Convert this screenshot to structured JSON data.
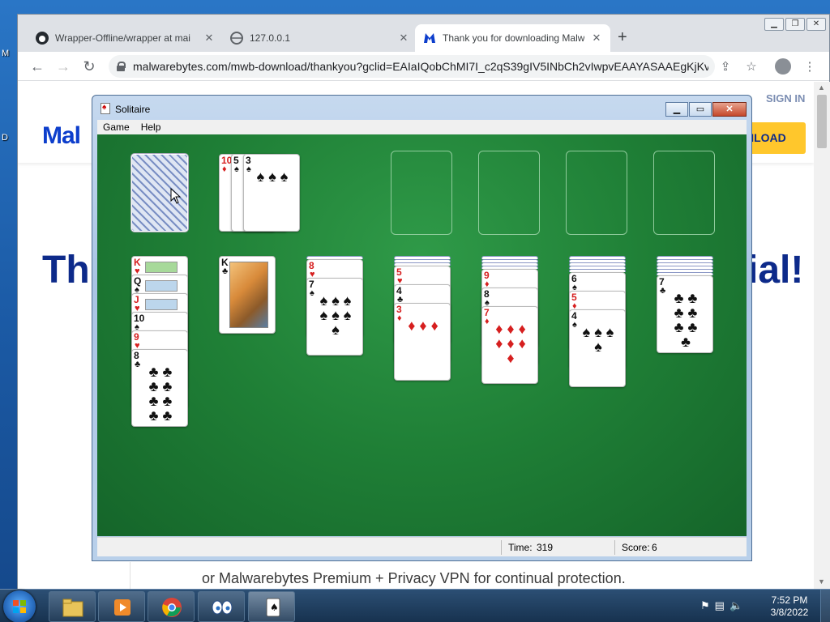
{
  "desktop": {
    "side_labels": [
      "M",
      "D"
    ]
  },
  "browser": {
    "tabs": [
      {
        "title": "Wrapper-Offline/wrapper at mai",
        "icon": "github-icon",
        "active": false
      },
      {
        "title": "127.0.0.1",
        "icon": "globe-icon",
        "active": false
      },
      {
        "title": "Thank you for downloading Malw",
        "icon": "malwarebytes-icon",
        "active": true
      }
    ],
    "new_tab": "+",
    "url": "malwarebytes.com/mwb-download/thankyou?gclid=EAIaIQobChMI7I_c2qS39gIV5INbCh2vIwpvEAAYASAAEgKjKv...",
    "page": {
      "sign_in": "SIGN IN",
      "logo_text": "Mal",
      "download_btn": "NLOAD",
      "hero_left": "Th",
      "hero_right": "ial!",
      "footer": "or Malwarebytes Premium + Privacy VPN for continual protection."
    }
  },
  "solitaire": {
    "title": "Solitaire",
    "menu": [
      "Game",
      "Help"
    ],
    "status": {
      "time_label": "Time:",
      "time_value": "319",
      "score_label": "Score:",
      "score_value": "6"
    },
    "waste": [
      {
        "rank": "10",
        "suit": "♦",
        "color": "red"
      },
      {
        "rank": "5",
        "suit": "♠",
        "color": "black"
      },
      {
        "rank": "3",
        "suit": "♠",
        "color": "black"
      }
    ],
    "tableau": [
      {
        "hidden": 0,
        "cards": [
          {
            "rank": "K",
            "suit": "♥",
            "color": "red"
          },
          {
            "rank": "Q",
            "suit": "♠",
            "color": "black"
          },
          {
            "rank": "J",
            "suit": "♥",
            "color": "red"
          },
          {
            "rank": "10",
            "suit": "♠",
            "color": "black"
          },
          {
            "rank": "9",
            "suit": "♥",
            "color": "red"
          },
          {
            "rank": "8",
            "suit": "♣",
            "color": "black"
          }
        ]
      },
      {
        "hidden": 0,
        "cards": [
          {
            "rank": "K",
            "suit": "♣",
            "color": "black"
          }
        ]
      },
      {
        "hidden": 1,
        "cards": [
          {
            "rank": "8",
            "suit": "♥",
            "color": "red"
          },
          {
            "rank": "7",
            "suit": "♠",
            "color": "black"
          }
        ]
      },
      {
        "hidden": 3,
        "cards": [
          {
            "rank": "5",
            "suit": "♥",
            "color": "red"
          },
          {
            "rank": "4",
            "suit": "♣",
            "color": "black"
          },
          {
            "rank": "3",
            "suit": "♦",
            "color": "red"
          }
        ]
      },
      {
        "hidden": 4,
        "cards": [
          {
            "rank": "9",
            "suit": "♦",
            "color": "red"
          },
          {
            "rank": "8",
            "suit": "♠",
            "color": "black"
          },
          {
            "rank": "7",
            "suit": "♦",
            "color": "red"
          }
        ]
      },
      {
        "hidden": 5,
        "cards": [
          {
            "rank": "6",
            "suit": "♠",
            "color": "black"
          },
          {
            "rank": "5",
            "suit": "♦",
            "color": "red"
          },
          {
            "rank": "4",
            "suit": "♠",
            "color": "black"
          }
        ]
      },
      {
        "hidden": 6,
        "cards": [
          {
            "rank": "7",
            "suit": "♣",
            "color": "black"
          }
        ]
      }
    ]
  },
  "taskbar": {
    "apps": [
      "explorer-icon",
      "media-player-icon",
      "chrome-icon",
      "eyes-icon",
      "solitaire-icon"
    ],
    "clock_time": "7:52 PM",
    "clock_date": "3/8/2022"
  },
  "colors": {
    "felt": "#1f7f36",
    "accent_blue": "#0d2a8a",
    "download_yellow": "#ffc72c"
  }
}
